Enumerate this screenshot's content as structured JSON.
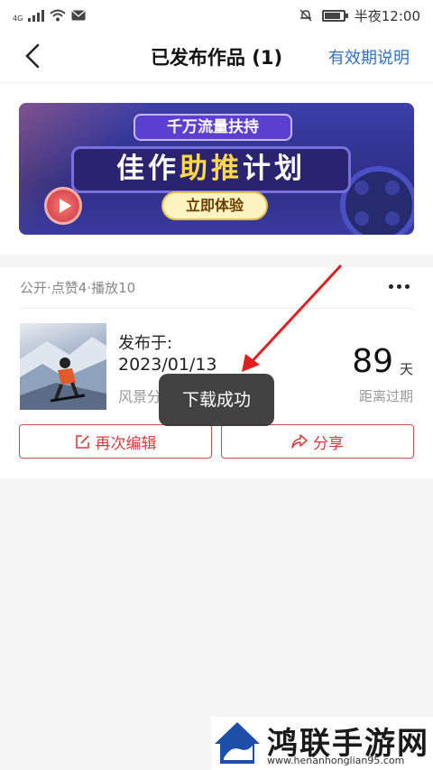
{
  "status_bar": {
    "network": "4G",
    "time": "半夜12:00",
    "battery_level": 0.85
  },
  "header": {
    "title": "已发布作品 (1)",
    "right_link": "有效期说明"
  },
  "banner": {
    "top_pill": "千万流量扶持",
    "main_prefix": "佳作",
    "main_highlight": "助推",
    "main_suffix": "计划",
    "button": "立即体验"
  },
  "work": {
    "stats": "公开·点赞4·播放10",
    "publish_label": "发布于:",
    "publish_date": "2023/01/13",
    "category": "风景分",
    "days_left": "89",
    "days_unit": "天",
    "expire_label": "距离过期",
    "edit_button": "再次编辑",
    "share_button": "分享"
  },
  "toast": {
    "text": "下载成功"
  },
  "watermark": {
    "title": "鸿联手游网",
    "url": "www.henanhonglian95.com"
  },
  "colors": {
    "accent_blue": "#2f6fc7",
    "accent_red": "#d83a3a",
    "annotation_red": "#e02020"
  }
}
